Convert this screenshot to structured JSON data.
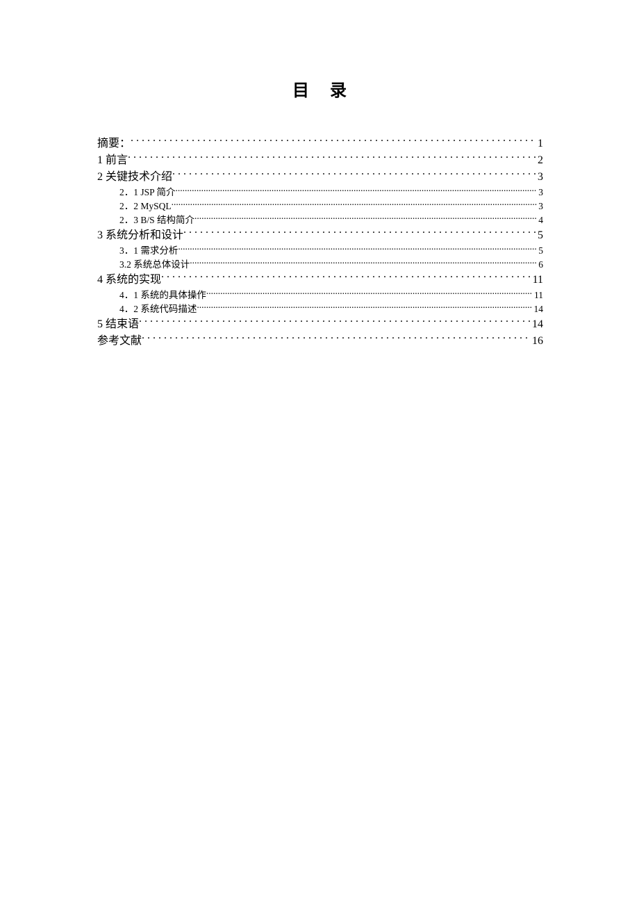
{
  "title": "目录",
  "entries": [
    {
      "level": 1,
      "label": "摘要：",
      "page": "1"
    },
    {
      "level": 1,
      "label": "1 前言",
      "page": "2"
    },
    {
      "level": 1,
      "label": "2 关键技术介绍",
      "page": "3"
    },
    {
      "level": 2,
      "label": "2．1 JSP 简介",
      "page": "3"
    },
    {
      "level": 2,
      "label": "2．2 MySQL",
      "page": "3"
    },
    {
      "level": 2,
      "label": "2．3 B/S 结构简介",
      "page": "4"
    },
    {
      "level": 1,
      "label": "3 系统分析和设计",
      "page": "5"
    },
    {
      "level": 2,
      "label": "3．1 需求分析",
      "page": "5"
    },
    {
      "level": 2,
      "label": "3.2 系统总体设计",
      "page": "6"
    },
    {
      "level": 1,
      "label": "4 系统的实现",
      "page": "11"
    },
    {
      "level": 2,
      "label": "4．1 系统的具体操作",
      "page": "11"
    },
    {
      "level": 2,
      "label": "4．2 系统代码描述",
      "page": "14"
    },
    {
      "level": 1,
      "label": "5 结束语",
      "page": "14"
    },
    {
      "level": 1,
      "label": "参考文献",
      "page": "16"
    }
  ]
}
